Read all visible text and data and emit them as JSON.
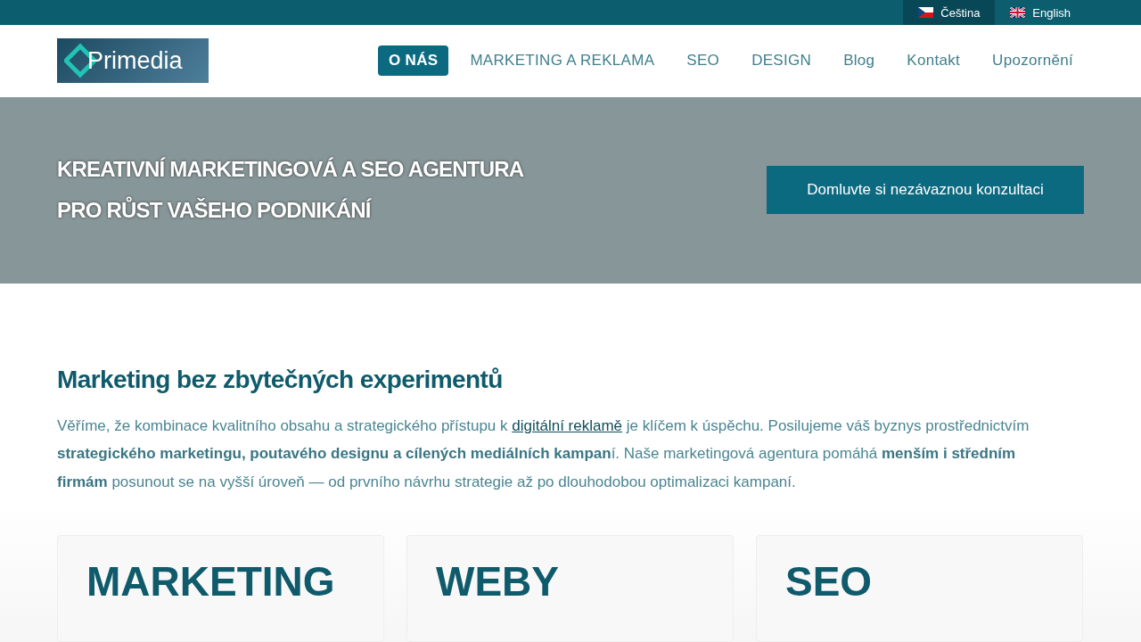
{
  "language_bar": [
    {
      "label": "Čeština",
      "selected": true
    },
    {
      "label": "English",
      "selected": false
    }
  ],
  "header": {
    "logo_text": "Primedia",
    "nav": [
      {
        "label": "O NÁS",
        "selected": true
      },
      {
        "label": "MARKETING A REKLAMA",
        "selected": false
      },
      {
        "label": "SEO",
        "selected": false
      },
      {
        "label": "DESIGN",
        "selected": false
      },
      {
        "label": "Blog",
        "selected": false
      },
      {
        "label": "Kontakt",
        "selected": false
      },
      {
        "label": "Upozornění",
        "selected": false
      }
    ]
  },
  "hero": {
    "lines": [
      "KREATIVNÍ MARKETINGOVÁ A SEO AGENTURA",
      "PRO RŮST VAŠEHO PODNIKÁNÍ"
    ],
    "button": "Domluvte si nezávaznou konzultaci"
  },
  "intro": {
    "heading": "Marketing bez zbytečných experimentů",
    "text_before": "Věříme, že kombinace kvalitního obsahu a strategického přístupu k",
    "link": "digitální reklamě",
    "text_after": "je klíčem k úspěchu. Posilujeme váš byznys prostřednictvím **strategického marketingu, poutavého designu a cílených mediálních kampan**í. Naše marketingová agentura pomáhá **menším i středním firmám** posunout se na vyšší úroveň — od prvního návrhu strategie až po dlouhodobou optimalizaci kampaní."
  },
  "cards": [
    {
      "title": "MARKETING"
    },
    {
      "title": "WEBY"
    },
    {
      "title": "SEO"
    }
  ]
}
